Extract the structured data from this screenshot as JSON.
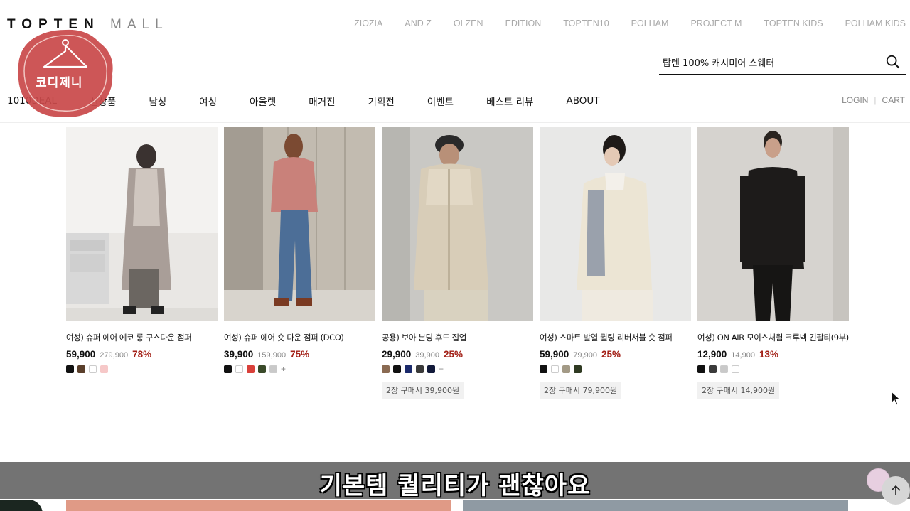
{
  "header": {
    "logo_main": "TOPTEN",
    "logo_sub": "MALL",
    "brands": [
      "ZIOZIA",
      "AND Z",
      "OLZEN",
      "EDITION",
      "TOPTEN10",
      "POLHAM",
      "PROJECT M",
      "TOPTEN KIDS",
      "POLHAM KIDS"
    ],
    "search_value": "탑텐 100% 캐시미어 스웨터",
    "search_icon": "search-icon"
  },
  "main_nav": {
    "items": [
      "1010DEAL",
      "신상품",
      "남성",
      "여성",
      "아울렛",
      "매거진",
      "기획전",
      "이벤트",
      "베스트 리뷰",
      "ABOUT"
    ],
    "login": "LOGIN",
    "cart": "CART"
  },
  "products": [
    {
      "name": "여성) 슈퍼 에어 에코 롱 구스다운 점퍼",
      "price": "59,900",
      "original_price": "279,900",
      "discount": "78%",
      "swatches": [
        "#111111",
        "#5a3f2b",
        "#ffffff",
        "#f6c8c8"
      ],
      "more": false,
      "bundle": ""
    },
    {
      "name": "여성) 슈퍼 에어 숏 다운 점퍼 (DCO)",
      "price": "39,900",
      "original_price": "159,900",
      "discount": "75%",
      "swatches": [
        "#111111",
        "#ffffff",
        "#d9403a",
        "#3a4a2a",
        "#c9c9c9"
      ],
      "more": true,
      "bundle": ""
    },
    {
      "name": "공용) 보아 본딩 후드 집업",
      "price": "29,900",
      "original_price": "39,900",
      "discount": "25%",
      "swatches": [
        "#8a6a52",
        "#111111",
        "#1b2a6b",
        "#3a3a3a",
        "#121a3a"
      ],
      "more": true,
      "bundle": "2장 구매시 39,900원"
    },
    {
      "name": "여성) 스마트 발열 퀼팅 리버서블 숏 점퍼",
      "price": "59,900",
      "original_price": "79,900",
      "discount": "25%",
      "swatches": [
        "#111111",
        "#ffffff",
        "#a39a86",
        "#2f3a22"
      ],
      "more": false,
      "bundle": "2장 구매시 79,900원"
    },
    {
      "name": "여성) ON AIR 모이스처웜 크루넥 긴팔티(9부)",
      "price": "12,900",
      "original_price": "14,900",
      "discount": "13%",
      "swatches": [
        "#111111",
        "#3a3a3a",
        "#c9c9c9",
        "#ffffff"
      ],
      "more": false,
      "bundle": "2장 구매시 14,900원"
    }
  ],
  "overlay": {
    "caption": "기본템 퀄리티가 괜찮아요",
    "watermark_text": "코디제니"
  }
}
